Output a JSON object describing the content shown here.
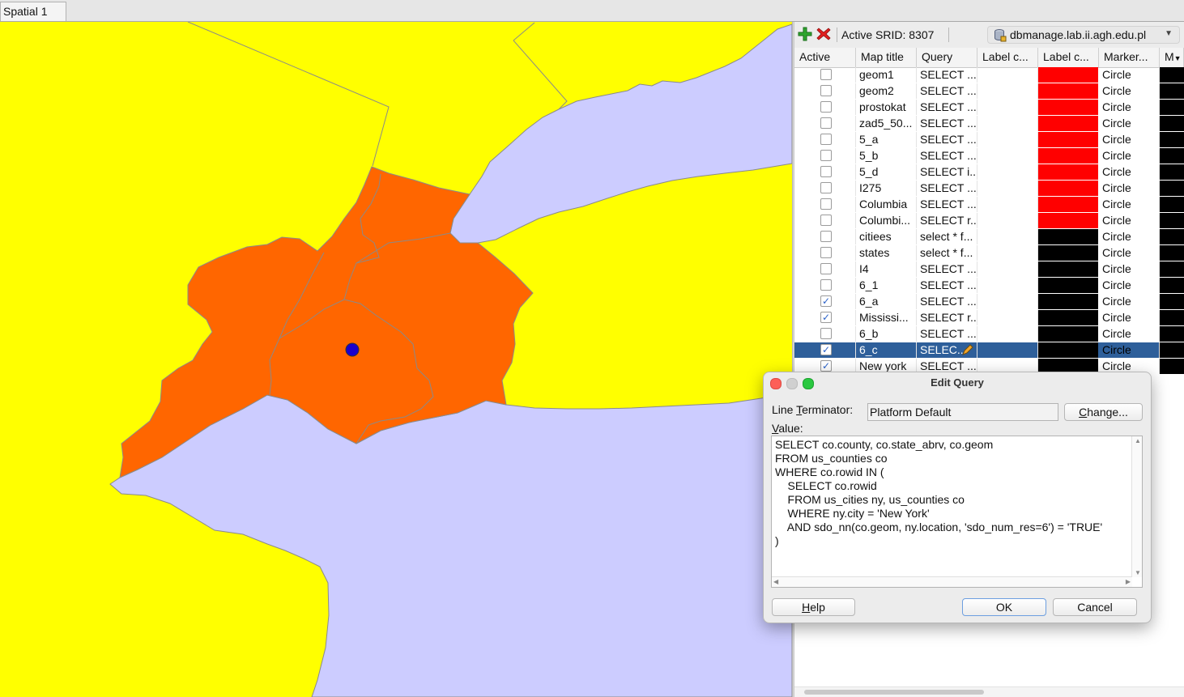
{
  "tab": {
    "label": "Spatial 1"
  },
  "colors": {
    "map_background": "#ffff00",
    "water": "#ccccff",
    "selected_counties": "#ff6600",
    "county_border": "#8a8a8a",
    "city_marker": "#1a00cc",
    "label_red": "#ff0000",
    "label_black": "#000000",
    "selection": "#2e5f9a"
  },
  "map": {
    "city_marker_icon": "circle-marker"
  },
  "toolbar": {
    "add_icon": "plus-icon",
    "remove_icon": "x-icon",
    "srid_text": "Active SRID: 8307",
    "connection": "dbmanage.lab.ii.agh.edu.pl"
  },
  "grid": {
    "headers": [
      "Active",
      "Map title",
      "Query",
      "Label c...",
      "Label c...",
      "Marker...",
      "M"
    ],
    "rows": [
      {
        "active": false,
        "title": "geom1",
        "query": "SELECT ...",
        "label_color": "red",
        "marker": "Circle"
      },
      {
        "active": false,
        "title": "geom2",
        "query": "SELECT ...",
        "label_color": "red",
        "marker": "Circle"
      },
      {
        "active": false,
        "title": "prostokat",
        "query": "SELECT  ...",
        "label_color": "red",
        "marker": "Circle"
      },
      {
        "active": false,
        "title": "zad5_50...",
        "query": "SELECT ...",
        "label_color": "red",
        "marker": "Circle"
      },
      {
        "active": false,
        "title": "5_a",
        "query": "SELECT ...",
        "label_color": "red",
        "marker": "Circle"
      },
      {
        "active": false,
        "title": "5_b",
        "query": "SELECT ...",
        "label_color": "red",
        "marker": "Circle"
      },
      {
        "active": false,
        "title": "5_d",
        "query": "SELECT i...",
        "label_color": "red",
        "marker": "Circle"
      },
      {
        "active": false,
        "title": "I275",
        "query": "SELECT ...",
        "label_color": "red",
        "marker": "Circle"
      },
      {
        "active": false,
        "title": "Columbia",
        "query": "SELECT ...",
        "label_color": "red",
        "marker": "Circle"
      },
      {
        "active": false,
        "title": "Columbi...",
        "query": "SELECT r...",
        "label_color": "red",
        "marker": "Circle"
      },
      {
        "active": false,
        "title": "citiees",
        "query": "select * f...",
        "label_color": "black",
        "marker": "Circle"
      },
      {
        "active": false,
        "title": "states",
        "query": "select * f...",
        "label_color": "black",
        "marker": "Circle"
      },
      {
        "active": false,
        "title": "I4",
        "query": "SELECT ...",
        "label_color": "black",
        "marker": "Circle"
      },
      {
        "active": false,
        "title": "6_1",
        "query": "SELECT ...",
        "label_color": "black",
        "marker": "Circle"
      },
      {
        "active": true,
        "title": "6_a",
        "query": "SELECT ...",
        "label_color": "black",
        "marker": "Circle"
      },
      {
        "active": true,
        "title": "Mississi...",
        "query": "SELECT r...",
        "label_color": "black",
        "marker": "Circle"
      },
      {
        "active": false,
        "title": "6_b",
        "query": "SELECT ...",
        "label_color": "black",
        "marker": "Circle"
      },
      {
        "active": true,
        "title": "6_c",
        "query": "SELEC...",
        "label_color": "black",
        "marker": "Circle",
        "selected": true
      },
      {
        "active": true,
        "title": "New york",
        "query": "SELECT ...",
        "label_color": "black",
        "marker": "Circle"
      }
    ]
  },
  "dialog": {
    "title": "Edit Query",
    "line_terminator_label_pre": "Line ",
    "line_terminator_label_u": "T",
    "line_terminator_label_post": "erminator:",
    "line_terminator_value": "Platform Default",
    "change_button_u": "C",
    "change_button_rest": "hange...",
    "value_label_u": "V",
    "value_label_rest": "alue:",
    "query_text": "SELECT co.county, co.state_abrv, co.geom\nFROM us_counties co\nWHERE co.rowid IN (\n    SELECT co.rowid\n    FROM us_cities ny, us_counties co\n    WHERE ny.city = 'New York'\n    AND sdo_nn(co.geom, ny.location, 'sdo_num_res=6') = 'TRUE'\n)",
    "help_button_u": "H",
    "help_button_rest": "elp",
    "ok_button": "OK",
    "cancel_button": "Cancel"
  }
}
